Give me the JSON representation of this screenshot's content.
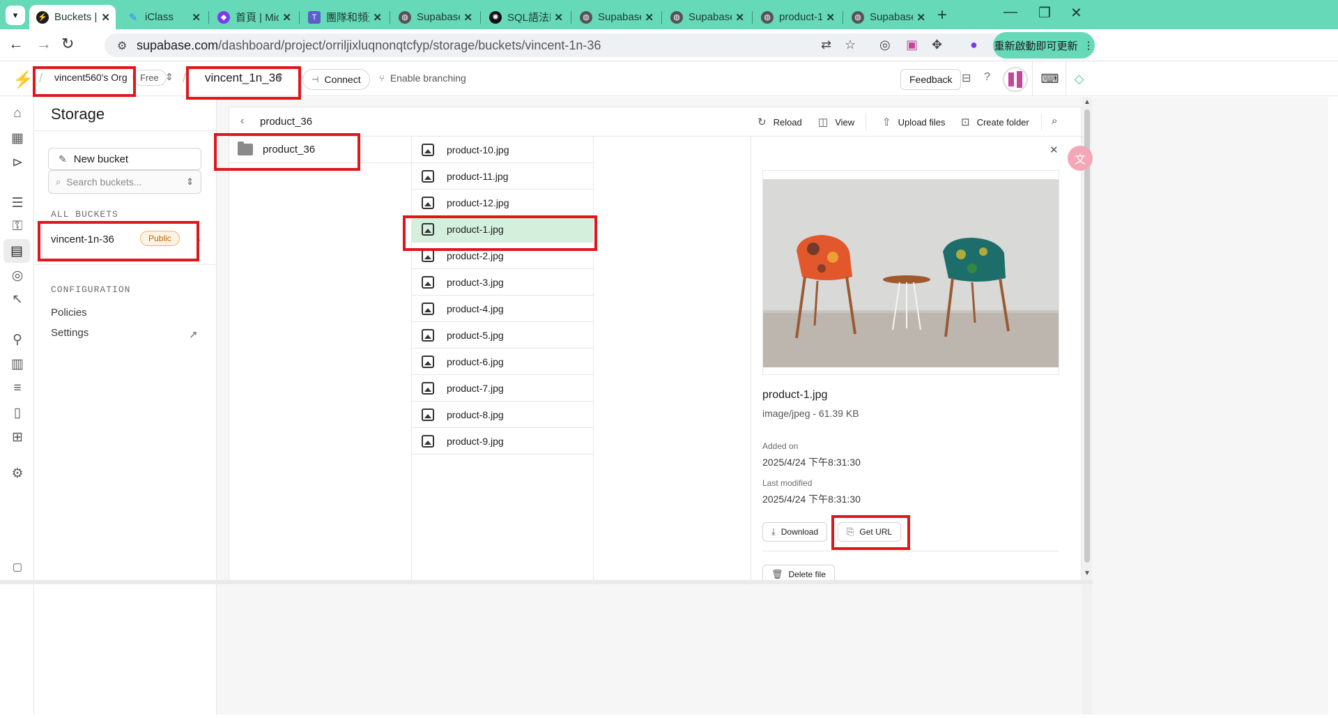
{
  "browser": {
    "tabs": [
      {
        "label": "Buckets | S",
        "icon": "supabase-icon",
        "color": "#3ecf8e"
      },
      {
        "label": "iClass",
        "icon": "iclass-icon",
        "color": "#3b82f6"
      },
      {
        "label": "首頁 | Mic",
        "icon": "copilot-icon",
        "color": "#7c3aed"
      },
      {
        "label": "團隊和頻道",
        "icon": "teams-icon",
        "color": "#5b5fc7"
      },
      {
        "label": "Supabase",
        "icon": "globe-icon",
        "color": "#555555"
      },
      {
        "label": "SQL語法範",
        "icon": "chatgpt-icon",
        "color": "#111111"
      },
      {
        "label": "Supabase",
        "icon": "globe-icon",
        "color": "#555555"
      },
      {
        "label": "Supabase",
        "icon": "globe-icon",
        "color": "#555555"
      },
      {
        "label": "product-1",
        "icon": "globe-icon",
        "color": "#555555"
      },
      {
        "label": "Supabase",
        "icon": "globe-icon",
        "color": "#555555"
      }
    ],
    "url_host": "supabase.com",
    "url_path": "/dashboard/project/orriljixluqnonqtcfyp/storage/buckets/vincent-1n-36",
    "update_button": "重新啟動即可更新"
  },
  "header": {
    "org_name": "vincent560's Org",
    "plan": "Free",
    "project_name": "vincent_1n_36",
    "connect_label": "Connect",
    "branching_label": "Enable branching",
    "feedback_label": "Feedback"
  },
  "storage": {
    "title": "Storage",
    "new_bucket_label": "New bucket",
    "search_placeholder": "Search buckets...",
    "all_buckets_label": "ALL BUCKETS",
    "bucket": {
      "name": "vincent-1n-36",
      "badge": "Public"
    },
    "configuration_label": "CONFIGURATION",
    "policies_label": "Policies",
    "settings_label": "Settings"
  },
  "explorer": {
    "path": "product_36",
    "reload_label": "Reload",
    "view_label": "View",
    "upload_label": "Upload files",
    "create_folder_label": "Create folder",
    "folder": "product_36",
    "files": [
      "product-10.jpg",
      "product-11.jpg",
      "product-12.jpg",
      "product-1.jpg",
      "product-2.jpg",
      "product-3.jpg",
      "product-4.jpg",
      "product-5.jpg",
      "product-6.jpg",
      "product-7.jpg",
      "product-8.jpg",
      "product-9.jpg"
    ],
    "selected_file": "product-1.jpg"
  },
  "preview": {
    "file_name": "product-1.jpg",
    "meta": "image/jpeg - 61.39 KB",
    "added_label": "Added on",
    "added_value": "2025/4/24 下午8:31:30",
    "modified_label": "Last modified",
    "modified_value": "2025/4/24 下午8:31:30",
    "download_label": "Download",
    "get_url_label": "Get URL",
    "delete_label": "Delete file"
  },
  "colors": {
    "brand": "#3ecf8e",
    "browser_accent": "#66d9b8",
    "selected_row": "#d5efdd",
    "annotation": "#e0161d",
    "public_badge": "#b66b00"
  }
}
